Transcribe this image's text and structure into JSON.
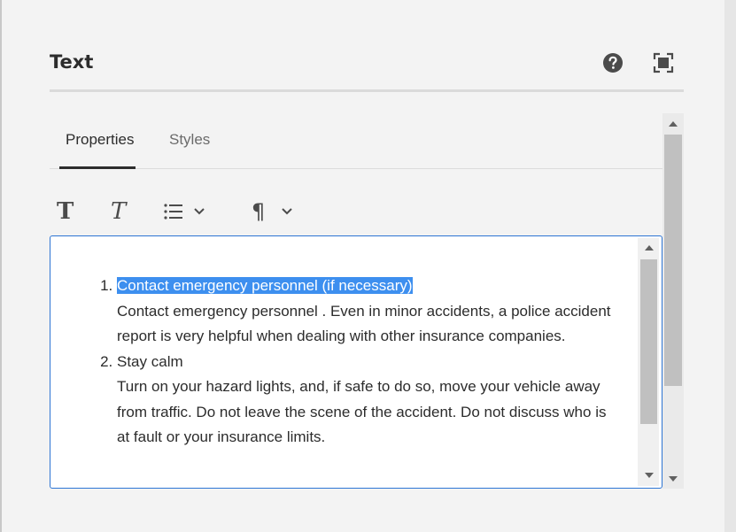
{
  "dialog": {
    "title": "Text",
    "help_icon": "help-circle-icon",
    "fullscreen_icon": "fullscreen-icon"
  },
  "tabs": [
    {
      "label": "Properties",
      "active": true
    },
    {
      "label": "Styles",
      "active": false
    }
  ],
  "toolbar": {
    "bold_glyph": "T",
    "italic_glyph": "T",
    "list_icon": "list-icon",
    "paragraph_glyph": "¶",
    "chevron_icon": "chevron-down-icon"
  },
  "editor": {
    "items": [
      {
        "heading": "Contact emergency personnel (if necessary)",
        "heading_selected": true,
        "body": "Contact emergency personnel . Even in minor accidents, a police accident report is very helpful when dealing with other insurance companies."
      },
      {
        "heading": "Stay calm",
        "heading_selected": false,
        "body": "Turn on your hazard lights, and, if safe to do so, move your vehicle away from traffic. Do not leave the scene of the accident. Do not discuss who is at fault or your insurance limits."
      }
    ]
  },
  "colors": {
    "accent": "#2d75d4",
    "selection": "#3d8fef",
    "dialog_bg": "#f3f3f3"
  }
}
